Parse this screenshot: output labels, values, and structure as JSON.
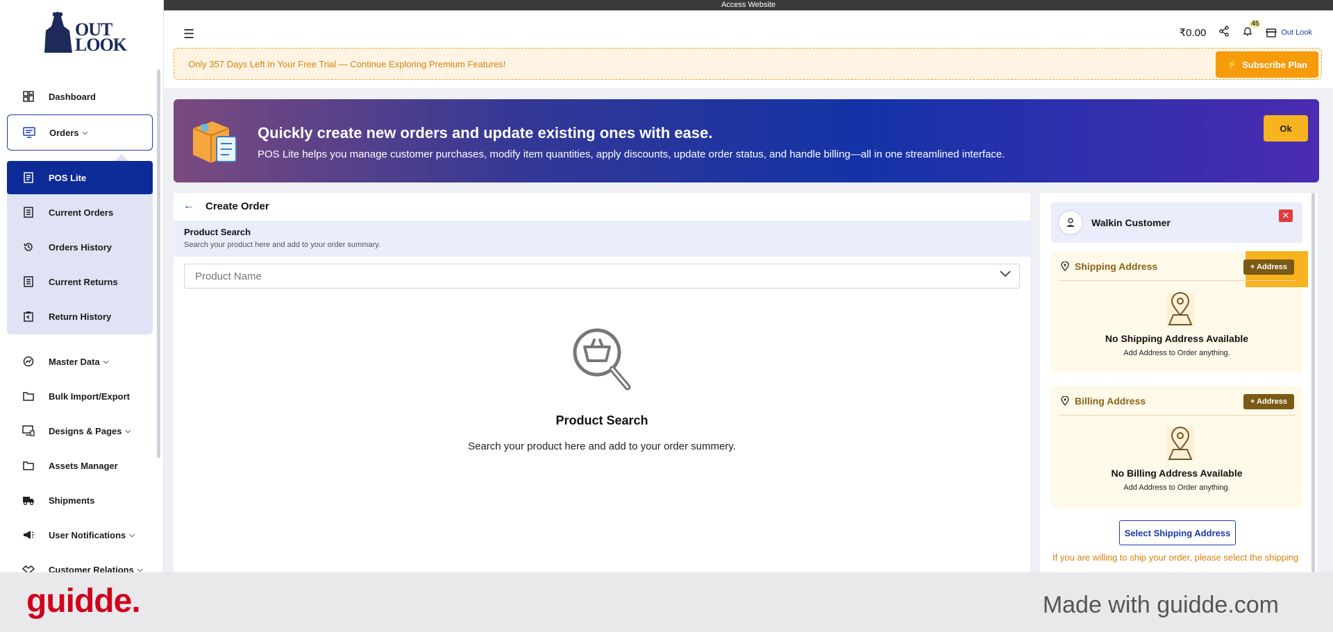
{
  "access_bar": "Access Website",
  "logo": {
    "text": "OUT LOOK"
  },
  "sidebar": {
    "items": [
      {
        "label": "Dashboard",
        "icon": "dashboard-icon"
      },
      {
        "label": "Orders",
        "icon": "orders-icon"
      },
      {
        "label": "POS Lite",
        "icon": "pos-icon"
      },
      {
        "label": "Current Orders",
        "icon": "list-icon"
      },
      {
        "label": "Orders History",
        "icon": "history-icon"
      },
      {
        "label": "Current Returns",
        "icon": "list-icon"
      },
      {
        "label": "Return History",
        "icon": "return-icon"
      },
      {
        "label": "Master Data",
        "icon": "master-data-icon"
      },
      {
        "label": "Bulk Import/Export",
        "icon": "folder-icon"
      },
      {
        "label": "Designs & Pages",
        "icon": "designs-icon"
      },
      {
        "label": "Assets Manager",
        "icon": "folder-icon"
      },
      {
        "label": "Shipments",
        "icon": "truck-icon"
      },
      {
        "label": "User Notifications",
        "icon": "megaphone-icon"
      },
      {
        "label": "Customer Relations",
        "icon": "handshake-icon"
      }
    ]
  },
  "header": {
    "balance": "₹0.00",
    "notification_count": "45",
    "store_name": "Out Look",
    "trial_text": "Only 357 Days Left In Your Free Trial — Continue Exploring Premium Features!",
    "subscribe_label": "Subscribe Plan"
  },
  "banner": {
    "title": "Quickly create new orders and update existing ones with ease.",
    "subtitle": "POS Lite helps you manage customer purchases, modify item quantities, apply discounts, update order status, and handle billing—all in one streamlined interface.",
    "ok_label": "Ok"
  },
  "create_order": {
    "title": "Create Order",
    "search_title": "Product Search",
    "search_sub": "Search your product here and add to your order summary.",
    "input_placeholder": "Product Name",
    "empty_title": "Product Search",
    "empty_sub": "Search your product here and add to your order summery."
  },
  "customer": {
    "name": "Walkin Customer",
    "shipping": {
      "title": "Shipping Address",
      "add_label": "+ Address",
      "none": "No Shipping Address Available",
      "hint": "Add Address to Order anything."
    },
    "billing": {
      "title": "Billing Address",
      "add_label": "+ Address",
      "none": "No Billing Address Available",
      "hint": "Add Address to Order anything."
    },
    "select_shipping_label": "Select Shipping Address",
    "ship_note": "If you are willing to ship your order, please select the shipping"
  },
  "footer": {
    "logo": "guidde.",
    "made_with": "Made with guidde.com"
  },
  "colors": {
    "primary": "#0d2c98",
    "accent": "#f59b0c",
    "address_brown": "#7a5a14",
    "brand_red": "#d0021b"
  }
}
